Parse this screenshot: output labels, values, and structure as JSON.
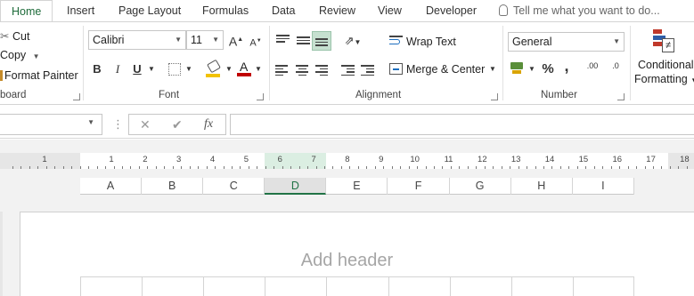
{
  "tabs": [
    {
      "label": "Home",
      "active": true
    },
    {
      "label": "Insert"
    },
    {
      "label": "Page Layout"
    },
    {
      "label": "Formulas"
    },
    {
      "label": "Data"
    },
    {
      "label": "Review"
    },
    {
      "label": "View"
    },
    {
      "label": "Developer"
    }
  ],
  "tell_me": "Tell me what you want to do...",
  "clipboard": {
    "cut": "Cut",
    "copy": "Copy",
    "format_painter": "Format Painter",
    "label": "board"
  },
  "font": {
    "name": "Calibri",
    "size": "11",
    "bold": "B",
    "italic": "I",
    "underline": "U",
    "grow": "A",
    "shrink": "A",
    "color_letter": "A",
    "label": "Font"
  },
  "alignment": {
    "wrap_text": "Wrap Text",
    "merge_center": "Merge & Center",
    "label": "Alignment"
  },
  "number": {
    "format": "General",
    "percent": "%",
    "comma": ",",
    "inc_decimal": ".00",
    "dec_decimal": ".0",
    "label": "Number"
  },
  "styles": {
    "conditional_formatting_1": "Conditional",
    "conditional_formatting_2": "Formatting"
  },
  "formula_bar": {
    "cancel": "✕",
    "enter": "✔",
    "fx": "fx"
  },
  "ruler_numbers": [
    "1",
    "1",
    "2",
    "3",
    "4",
    "5",
    "6",
    "7",
    "8",
    "9",
    "10",
    "11",
    "12",
    "13",
    "14",
    "15",
    "16",
    "17",
    "18"
  ],
  "columns": [
    "A",
    "B",
    "C",
    "D",
    "E",
    "F",
    "G",
    "H",
    "I"
  ],
  "selected_column": "D",
  "page": {
    "add_header": "Add header"
  },
  "colors": {
    "accent": "#217346",
    "highlight": "#c6e0d0",
    "fill_yellow": "#f2c200",
    "font_red": "#c00000"
  }
}
